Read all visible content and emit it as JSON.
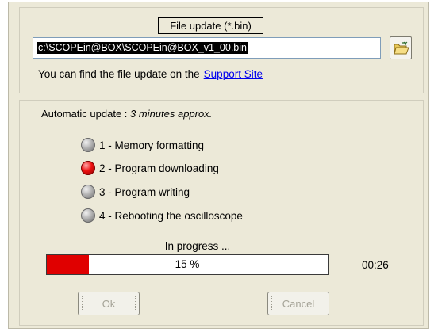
{
  "file_update": {
    "title": "File update (*.bin)",
    "path_value": "c:\\SCOPEin@BOX\\SCOPEin@BOX_v1_00.bin",
    "browse_icon": "folder-open-icon",
    "hint_text": "You can find the file update on the",
    "support_link": "Support Site"
  },
  "automatic": {
    "prefix": "Automatic update : ",
    "duration": "3 minutes approx."
  },
  "steps": [
    {
      "label": "1 - Memory formatting",
      "state": "done",
      "led_color": "#a8a8a8"
    },
    {
      "label": "2 - Program downloading",
      "state": "active",
      "led_color": "#ee1010"
    },
    {
      "label": "3 - Program writing",
      "state": "pending",
      "led_color": "#a8a8a8"
    },
    {
      "label": "4 - Rebooting the oscilloscope",
      "state": "pending",
      "led_color": "#a8a8a8"
    }
  ],
  "progress": {
    "status": "In progress ...",
    "percent_text": "15 %",
    "fraction": 0.15,
    "elapsed": "00:26",
    "fill_color": "#e00000"
  },
  "buttons": {
    "ok_label": "Ok",
    "cancel_label": "Cancel",
    "enabled": false
  }
}
